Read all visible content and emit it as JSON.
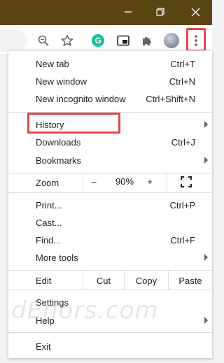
{
  "window": {
    "controls": [
      "minimize-icon",
      "restore-icon",
      "close-icon"
    ],
    "titlebar_color": "#5b4513"
  },
  "toolbar": {
    "icons": [
      "zoom-icon",
      "star-icon",
      "grammarly-icon",
      "picture-in-picture-icon",
      "extensions-icon",
      "profile-avatar",
      "menu-dots-icon"
    ],
    "grammarly_letter": "G"
  },
  "menu": {
    "new_tab": {
      "label": "New tab",
      "shortcut": "Ctrl+T"
    },
    "new_window": {
      "label": "New window",
      "shortcut": "Ctrl+N"
    },
    "new_incognito": {
      "label": "New incognito window",
      "shortcut": "Ctrl+Shift+N"
    },
    "history": {
      "label": "History"
    },
    "downloads": {
      "label": "Downloads",
      "shortcut": "Ctrl+J"
    },
    "bookmarks": {
      "label": "Bookmarks"
    },
    "zoom": {
      "label": "Zoom",
      "minus": "–",
      "level": "90%",
      "plus": "+"
    },
    "print": {
      "label": "Print...",
      "shortcut": "Ctrl+P"
    },
    "cast": {
      "label": "Cast..."
    },
    "find": {
      "label": "Find...",
      "shortcut": "Ctrl+F"
    },
    "more_tools": {
      "label": "More tools"
    },
    "edit": {
      "label": "Edit",
      "cut": "Cut",
      "copy": "Copy",
      "paste": "Paste"
    },
    "settings": {
      "label": "Settings"
    },
    "help": {
      "label": "Help"
    },
    "exit": {
      "label": "Exit"
    }
  },
  "highlight_color": "#e0474c",
  "watermark": "dEnors.com"
}
